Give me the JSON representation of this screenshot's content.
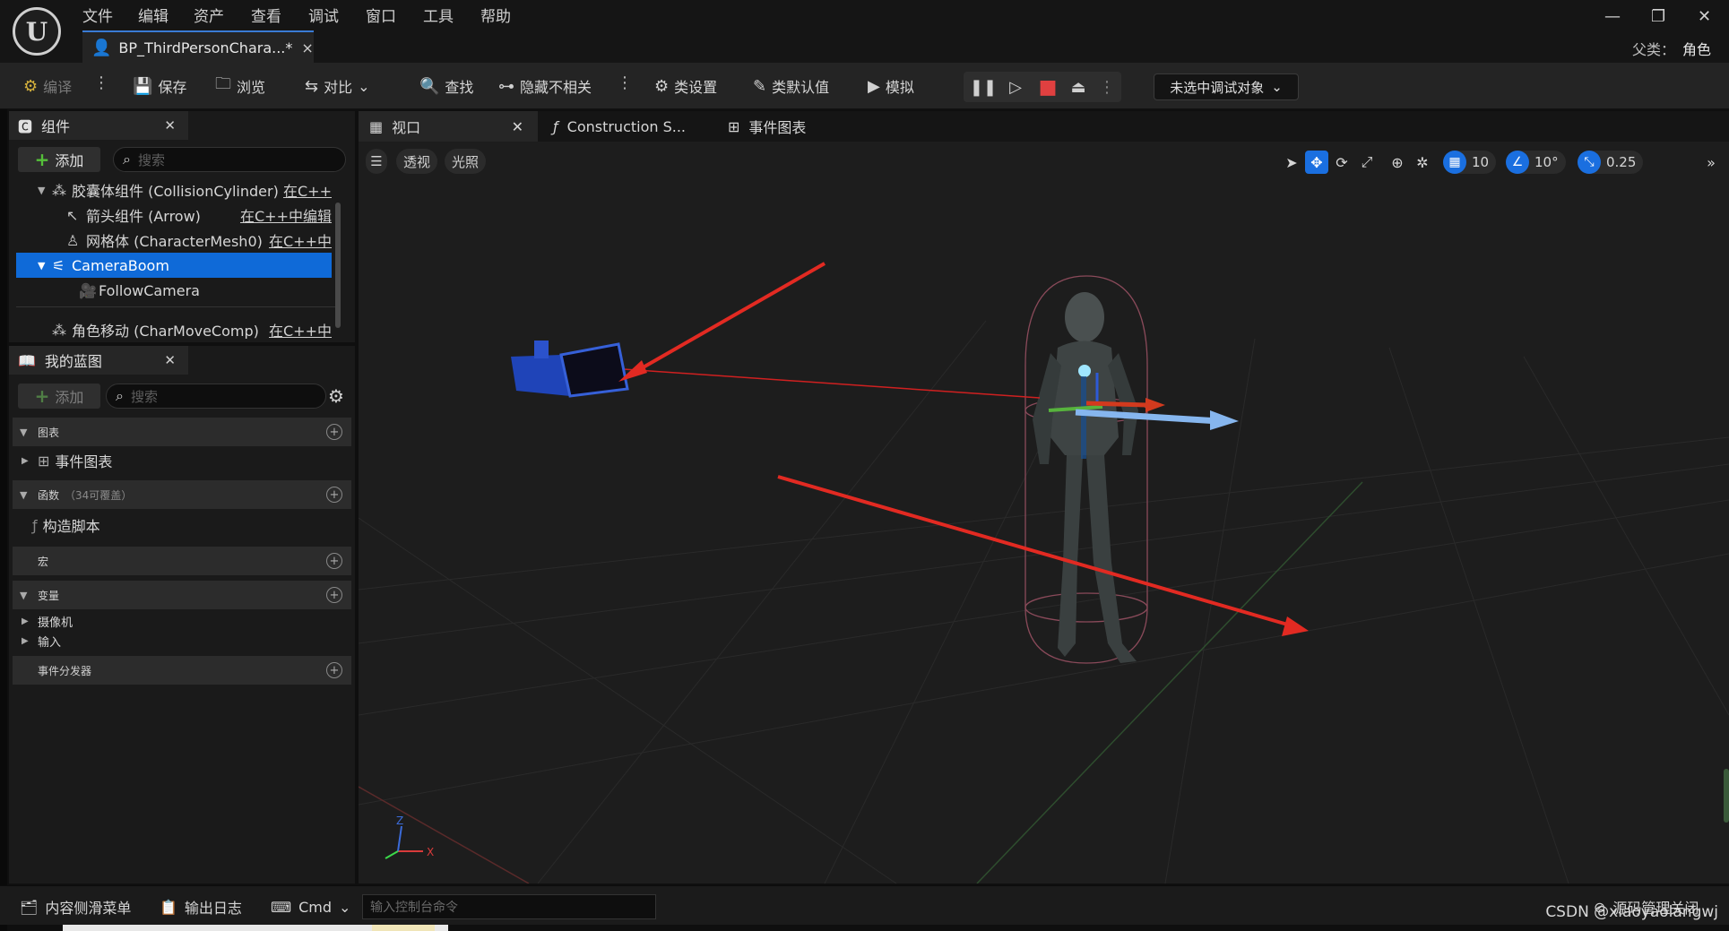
{
  "menu": [
    "文件",
    "编辑",
    "资产",
    "查看",
    "调试",
    "窗口",
    "工具",
    "帮助"
  ],
  "doc_tab": {
    "title": "BP_ThirdPersonChara...*",
    "close": "×"
  },
  "window_buttons": {
    "minimize": "—",
    "restore": "❐",
    "close": "✕"
  },
  "parent_class": {
    "label": "父类：",
    "value": "角色"
  },
  "toolbar": {
    "compile": "编译",
    "save": "保存",
    "browse": "浏览",
    "diff": "对比",
    "find": "查找",
    "hide_unrelated": "隐藏不相关",
    "class_settings": "类设置",
    "class_defaults": "类默认值",
    "simulate": "模拟",
    "debug_object": "未选中调试对象"
  },
  "components": {
    "tab": "组件",
    "add": "添加",
    "search_placeholder": "搜索",
    "rows": [
      {
        "label": "胶囊体组件 (CollisionCylinder)",
        "edit": "在C++"
      },
      {
        "label": "箭头组件 (Arrow)",
        "edit": "在C++中编辑"
      },
      {
        "label": "网格体 (CharacterMesh0)",
        "edit": "在C++中"
      },
      {
        "label": "CameraBoom",
        "edit": ""
      },
      {
        "label": "FollowCamera",
        "edit": ""
      },
      {
        "label": "角色移动 (CharMoveComp)",
        "edit": "在C++中"
      }
    ]
  },
  "my_blueprint": {
    "tab": "我的蓝图",
    "add": "添加",
    "search_placeholder": "搜索",
    "sections": {
      "graphs": "图表",
      "event_graph": "事件图表",
      "functions": "函数",
      "functions_count": "（34可覆盖）",
      "construction_script": "构造脚本",
      "macros": "宏",
      "variables": "变量",
      "var_camera": "摄像机",
      "var_input": "输入",
      "dispatchers": "事件分发器"
    }
  },
  "viewport_tabs": {
    "viewport": "视口",
    "construction": "Construction S...",
    "event_graph": "事件图表"
  },
  "viewport": {
    "perspective": "透视",
    "lit": "光照",
    "grid_snap": "10",
    "rot_snap": "10°",
    "scale_snap": "0.25",
    "axis_x": "X",
    "axis_z": "Z"
  },
  "bottom": {
    "content_drawer": "内容侧滑菜单",
    "output_log": "输出日志",
    "cmd": "Cmd",
    "console_placeholder": "输入控制台命令",
    "source_control": "源码管理关闭"
  },
  "watermark": "CSDN @xiaoyaolangwj"
}
